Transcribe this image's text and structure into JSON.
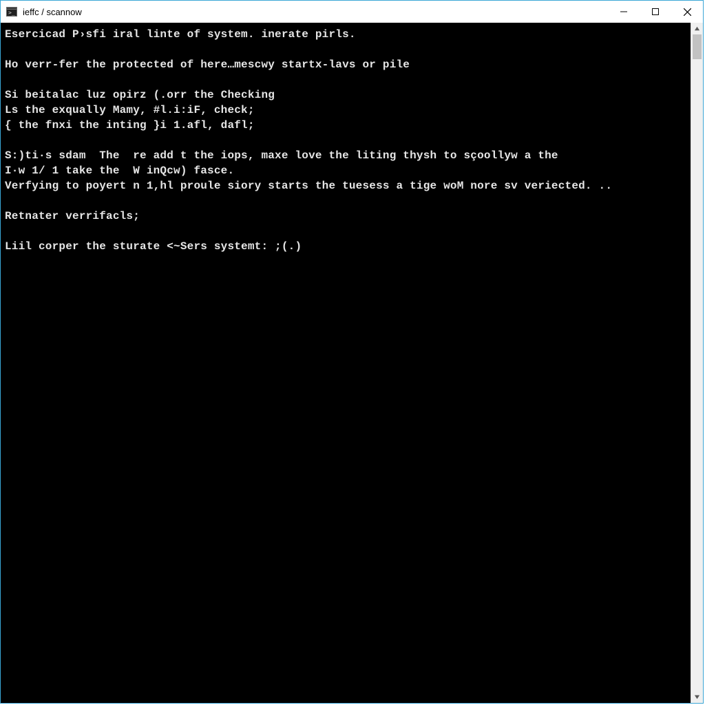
{
  "window": {
    "title": "ieffc  / scannow"
  },
  "terminal": {
    "lines": [
      "Esercicad P›sfi iral linte of system. inerate pirls.",
      "",
      "Ho verr-fer the protected of here…mescwy startx-lavs or pile",
      "",
      "Si beitalас luz opirz (.orr the Checking",
      "Ls the exqually Mamy, #l.i:iF, check;",
      "{ the fnxi the inting }i 1.afl, dafl;",
      "",
      "S:)ti·s sdam  The  re add t the iops, maxe love the liting thysh to sçoollyw a the",
      "I·w 1/ 1 take the  W inQcw) fasce.",
      "Verfying to poyert n 1,hl proule siory starts the tuesess a tige woM nore sv veriected. ..",
      "",
      "Retnater verrifacls;",
      "",
      "Liil corper the sturate <~Sers systemt: ;(.)"
    ]
  }
}
